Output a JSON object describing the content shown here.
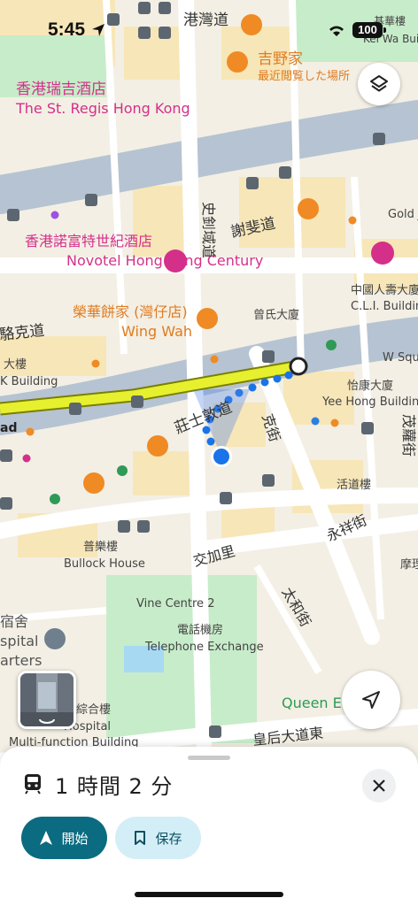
{
  "status_bar": {
    "time": "5:45",
    "battery": "100"
  },
  "map": {
    "places": [
      {
        "name": "香港瑞吉酒店",
        "sub": "The St. Regis Hong Kong",
        "color": "#d4308a"
      },
      {
        "name": "香港諾富特世紀酒店",
        "sub": "Novotel Hong Kong Century",
        "color": "#d4308a"
      },
      {
        "name": "吉野家",
        "sub": "最近閲覧した場所",
        "color": "#e07b20"
      },
      {
        "name": "榮華餅家 (灣仔店)",
        "sub": "Wing Wah",
        "color": "#e07b20"
      },
      {
        "name": "Queen El",
        "sub": "",
        "color": "#2e9a56"
      }
    ],
    "streets": [
      "港灣道",
      "謝斐道",
      "史釗域道",
      "駱克道",
      "莊士敦道",
      "克街",
      "交加里",
      "永祥街",
      "太和街",
      "皇后大道東",
      "茂蘿街"
    ],
    "buildings": [
      "曾氏大廈",
      "中國人壽大廈",
      "C.L.I. Building",
      "怡康大廈",
      "Yee Hong Building",
      "活道樓",
      "普樂樓",
      "Bullock House",
      "Vine Centre 2",
      "電話機房",
      "Telephone Exchange",
      "Gold J",
      "W Squ",
      "Multi-function Building",
      "Hospital",
      "摩理",
      "K Building",
      "基華樓",
      "Kei Wa Buildi",
      "大樓"
    ],
    "partial_labels": [
      "宿舍",
      "spital",
      "arters",
      "綜合樓",
      "ad"
    ]
  },
  "buttons": {
    "layers": "layers",
    "recenter": "navigation-arrow"
  },
  "sheet": {
    "duration": "1 時間 2 分",
    "start_label": "開始",
    "save_label": "保存"
  },
  "colors": {
    "route": "#e6f02e",
    "walk": "#1a73e8",
    "accent": "#0b6b80"
  }
}
